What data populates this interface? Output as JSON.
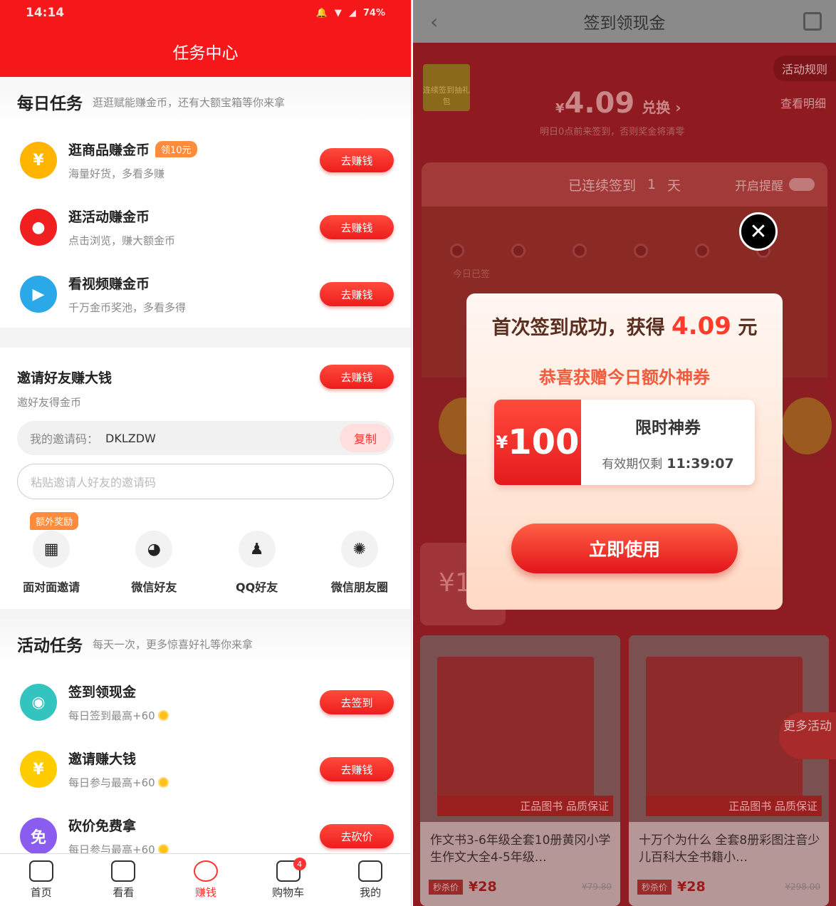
{
  "left": {
    "status": {
      "time": "14:14",
      "battery": "74%"
    },
    "title": "任务中心",
    "daily": {
      "heading": "每日任务",
      "sub": "逛逛赋能赚金币，还有大额宝箱等你来拿",
      "tasks": [
        {
          "name": "逛商品赚金币",
          "badge": "领10元",
          "desc": "海量好货，多看多赚",
          "btn": "去赚钱",
          "icon": "yen-coin-icon",
          "color": "#ffb400"
        },
        {
          "name": "逛活动赚金币",
          "desc": "点击浏览，赚大额金币",
          "btn": "去赚钱",
          "icon": "red-envelope-icon",
          "color": "#f02020"
        },
        {
          "name": "看视频赚金币",
          "desc": "千万金币奖池，多看多得",
          "btn": "去赚钱",
          "icon": "play-icon",
          "color": "#2aa8e8"
        }
      ]
    },
    "invite": {
      "title": "邀请好友赚大钱",
      "sub": "邀好友得金币",
      "btn": "去赚钱",
      "code_label": "我的邀请码：",
      "code": "DKLZDW",
      "copy": "复制",
      "paste_placeholder": "粘贴邀请人好友的邀请码",
      "shares": [
        {
          "label": "面对面邀请",
          "badge": "额外奖励",
          "icon": "qr-code-icon"
        },
        {
          "label": "微信好友",
          "icon": "wechat-icon"
        },
        {
          "label": "QQ好友",
          "icon": "qq-icon"
        },
        {
          "label": "微信朋友圈",
          "icon": "moments-icon"
        }
      ]
    },
    "activity": {
      "heading": "活动任务",
      "sub": "每天一次，更多惊喜好礼等你来拿",
      "tasks": [
        {
          "name": "签到领现金",
          "desc": "每日签到最高+60",
          "btn": "去签到",
          "icon": "location-pin-icon",
          "color": "#33c4c0"
        },
        {
          "name": "邀请赚大钱",
          "desc": "每日参与最高+60",
          "btn": "去赚钱",
          "icon": "yen-coin-icon",
          "color": "#ffcc00"
        },
        {
          "name": "砍价免费拿",
          "desc": "每日参与最高+60",
          "btn": "去砍价",
          "icon": "gift-icon",
          "color": "#8a5cf0"
        }
      ]
    },
    "tabs": [
      {
        "label": "首页",
        "icon": "home-icon"
      },
      {
        "label": "看看",
        "icon": "video-icon"
      },
      {
        "label": "赚钱",
        "icon": "money-bag-icon",
        "active": true
      },
      {
        "label": "购物车",
        "icon": "cart-icon",
        "badge": "4"
      },
      {
        "label": "我的",
        "icon": "profile-icon"
      }
    ]
  },
  "right": {
    "title": "签到领现金",
    "rule": "活动规则",
    "ledger": "查看明细",
    "amount": "4.09",
    "currency": "¥",
    "exchange": "兑换 ›",
    "notice": "明日0点前来签到，否则奖金将清零",
    "gift_label": "连续签到抽礼包",
    "signed": "已连续签到",
    "signed_days": "1",
    "signed_unit": "天",
    "remind": "开启提醒",
    "today": "今日已签",
    "modal": {
      "title_pre": "首次签到成功，获得 ",
      "title_amount": "4.09",
      "title_unit": " 元",
      "sub": "恭喜获赠今日额外神券",
      "coupon_currency": "¥",
      "coupon_value": "100",
      "coupon_title": "限时神券",
      "valid_label": "有效期仅剩",
      "valid_time": "11:39:07",
      "use_btn": "立即使用"
    },
    "products": [
      {
        "name": "作文书3-6年级全套10册黄冈小学生作文大全4-5年级…",
        "price": "¥28",
        "old": "¥79.80",
        "tag": "正品图书 品质保证",
        "label": "秒杀价"
      },
      {
        "name": "十万个为什么 全套8册彩图注音少儿百科大全书籍小…",
        "price": "¥28",
        "old": "¥298.00",
        "tag": "正品图书 品质保证",
        "label": "秒杀价"
      }
    ],
    "more": "更多活动"
  }
}
